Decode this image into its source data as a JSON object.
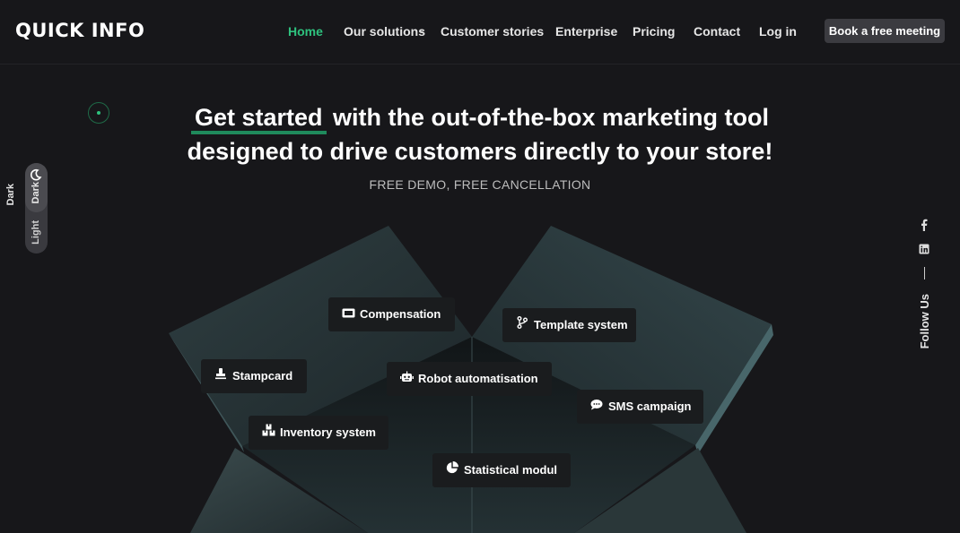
{
  "header": {
    "logo": "QUICK INFO",
    "nav": [
      {
        "label": "Home",
        "active": true
      },
      {
        "label": "Our solutions"
      },
      {
        "label": "Customer stories"
      },
      {
        "label": "Enterprise"
      },
      {
        "label": "Pricing"
      },
      {
        "label": "Contact"
      },
      {
        "label": "Log in"
      }
    ],
    "cta": "Book a free meeting"
  },
  "hero": {
    "highlight": "Get started",
    "headline_rest": " with the out-of-the-box marketing tool",
    "headline_line2": "designed to drive customers directly to your store!",
    "subtitle": "FREE DEMO, FREE CANCELLATION"
  },
  "theme_toggle": {
    "dark": "Dark",
    "light": "Light"
  },
  "social": {
    "follow": "Follow Us",
    "icons": [
      "facebook-icon",
      "linkedin-icon"
    ]
  },
  "features": [
    {
      "label": "Compensation",
      "icon": "ticket-icon"
    },
    {
      "label": "Template system",
      "icon": "branch-icon"
    },
    {
      "label": "Stampcard",
      "icon": "stamp-icon"
    },
    {
      "label": "Robot automatisation",
      "icon": "robot-icon"
    },
    {
      "label": "SMS campaign",
      "icon": "chat-icon"
    },
    {
      "label": "Inventory system",
      "icon": "boxes-icon"
    },
    {
      "label": "Statistical modul",
      "icon": "pie-chart-icon"
    }
  ],
  "colors": {
    "accent": "#2ec27e",
    "background": "#17171a",
    "button": "#3b3b40"
  }
}
